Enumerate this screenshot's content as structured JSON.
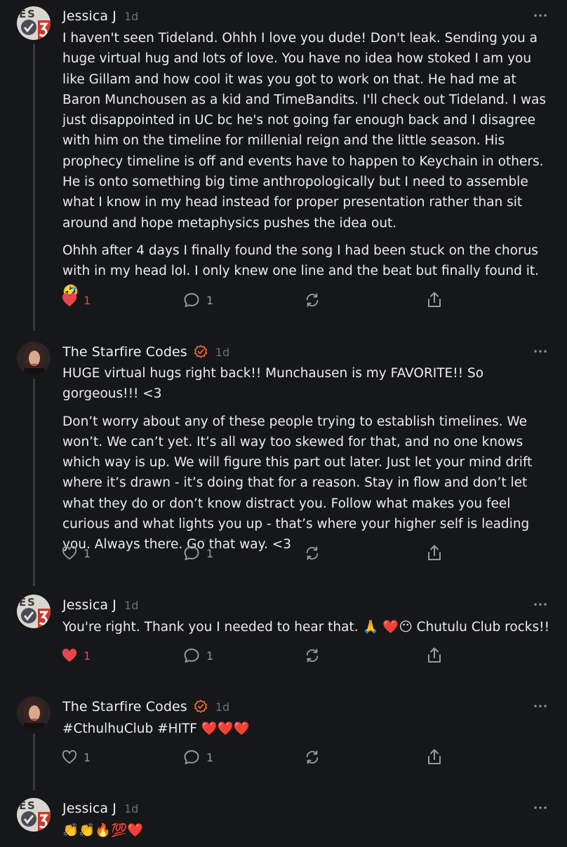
{
  "comments": [
    {
      "author": "Jessica J",
      "avatar": "jessica-avatar",
      "verified": false,
      "time": "1d",
      "paragraphs": [
        "I haven't seen Tideland. Ohhh I love you dude! Don't leak. Sending you a huge virtual hug and lots of love. You have no idea how stoked I am you like Gillam and how cool it was you got to work on that. He had me at Baron Munchousen as a kid and TimeBandits. I'll check out Tideland. I was just disappointed in UC bc he's not going far enough back and I disagree with him on the timeline for millenial reign and the little season. His prophecy timeline is off and events have to happen to Keychain in others. He is onto something big time anthropologically but I need to assemble what I know in my head instead for proper presentation rather than sit around and hope metaphysics pushes the idea out.",
        "Ohhh after 4 days I finally found the song I had been stuck on the chorus with in my head lol. I only knew one line and the beat but finally found it. 🤣"
      ],
      "likes": "1",
      "liked": true,
      "replies": "1"
    },
    {
      "author": "The Starfire Codes",
      "avatar": "starfire-avatar",
      "verified": true,
      "time": "1d",
      "paragraphs": [
        "HUGE virtual hugs right back!! Munchausen is my FAVORITE!! So gorgeous!!! <3",
        "Don’t worry about any of these people trying to establish timelines. We won’t. We can’t yet. It’s all way too skewed for that, and no one knows which way is up. We will figure this part out later. Just let your mind drift where it’s drawn - it’s doing that for a reason. Stay in flow and don’t let what they do or don’t know distract you. Follow what makes you feel curious and what lights you up - that’s where your higher self is leading you. Always there. Go that way. <3"
      ],
      "likes": "1",
      "liked": false,
      "replies": "1"
    },
    {
      "author": "Jessica J",
      "avatar": "jessica-avatar",
      "verified": false,
      "time": "1d",
      "paragraphs": [
        "You're right. Thank you I needed to hear that. 🙏 ❤️😶 Chutulu Club rocks!!"
      ],
      "likes": "1",
      "liked": true,
      "replies": "1"
    },
    {
      "author": "The Starfire Codes",
      "avatar": "starfire-avatar",
      "verified": true,
      "time": "1d",
      "paragraphs": [
        "#CthulhuClub #HITF ❤️❤️❤️"
      ],
      "likes": "1",
      "liked": false,
      "replies": "1"
    },
    {
      "author": "Jessica J",
      "avatar": "jessica-avatar",
      "verified": false,
      "time": "1d",
      "paragraphs": [
        "👏👏🔥💯❤️"
      ],
      "likes": null,
      "liked": false,
      "replies": null
    }
  ],
  "icons": {
    "like": "heart-icon",
    "reply": "comment-bubble-icon",
    "restack": "restack-icon",
    "share": "share-icon",
    "more": "more-dots-icon",
    "verified": "verified-check-icon"
  },
  "colors": {
    "background": "#161719",
    "text": "#ececec",
    "muted": "#6f7075",
    "liked": "#e8454f",
    "verified": "#ef6b2e",
    "thread_line": "#3a3b3f"
  }
}
